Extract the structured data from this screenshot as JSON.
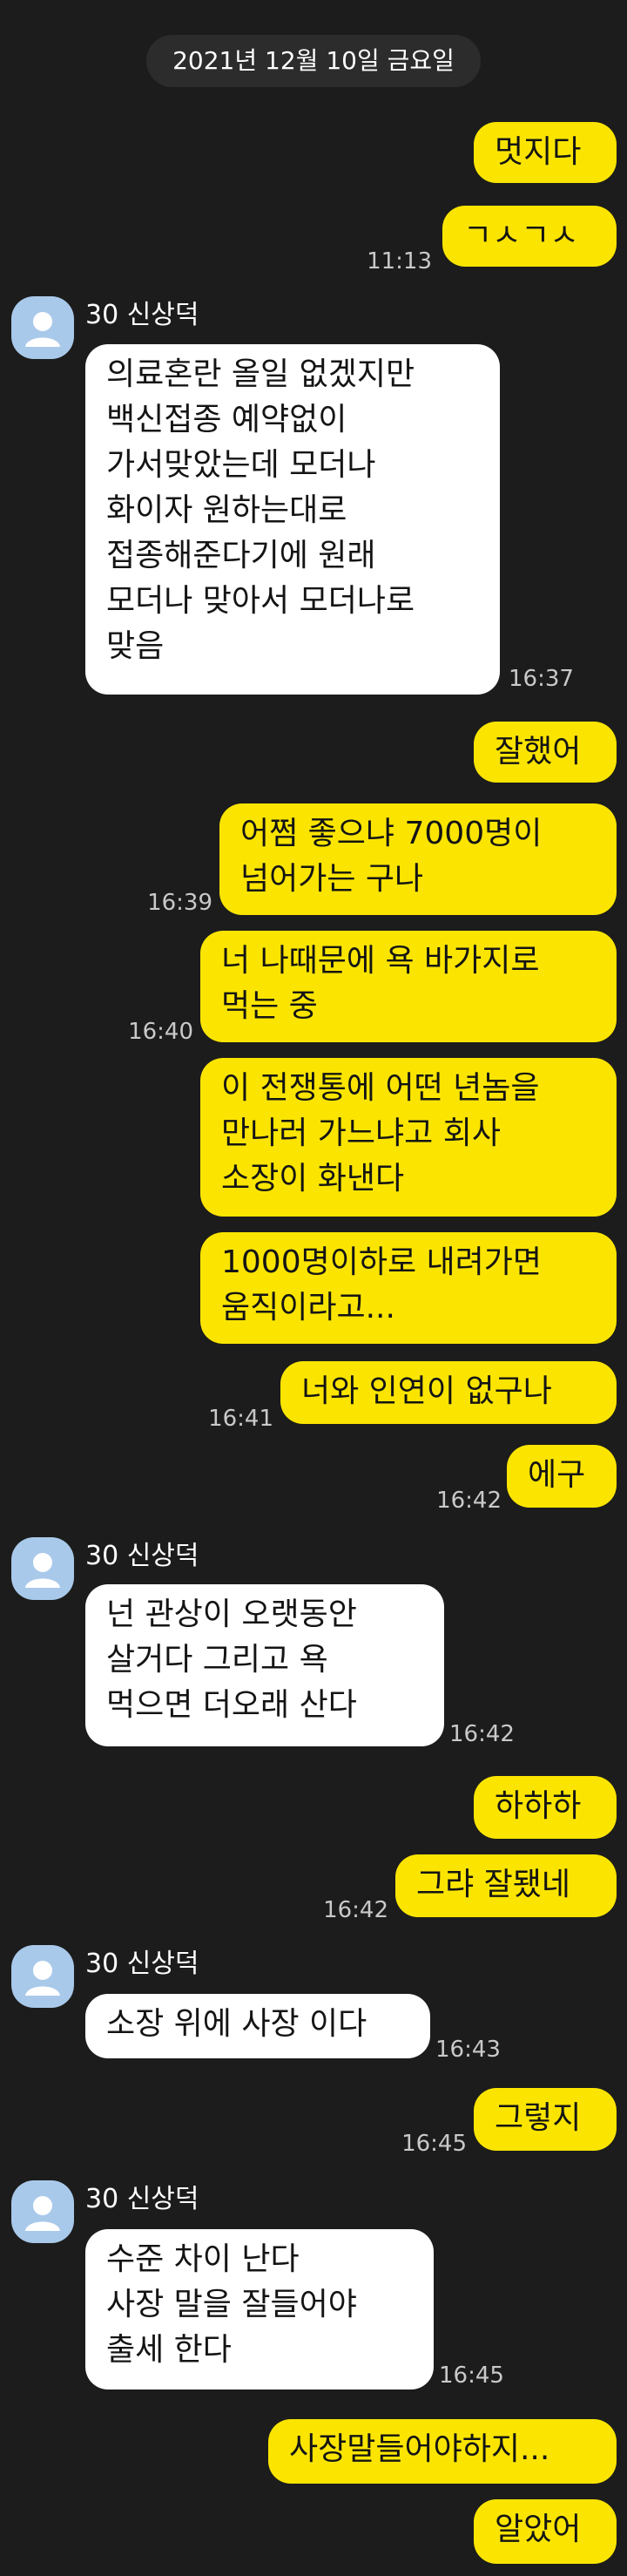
{
  "date_divider": "2021년 12월 10일 금요일",
  "peer_name": "30 신상덕",
  "messages": [
    {
      "from": "me",
      "text": "멋지다"
    },
    {
      "from": "me",
      "text": "ㄱㅅㄱㅅ",
      "time": "11:13"
    },
    {
      "from": "peer",
      "text": "의료혼란 올일 없겠지만\n백신접종 예약없이\n가서맞았는데 모더나\n화이자 원하는대로\n접종해준다기에 원래\n모더나 맞아서 모더나로\n맞음",
      "time": "16:37"
    },
    {
      "from": "me",
      "text": "잘했어"
    },
    {
      "from": "me",
      "text": "어쩜 좋으냐 7000명이\n넘어가는 구나",
      "time": "16:39"
    },
    {
      "from": "me",
      "text": "너 나때문에 욕 바가지로\n먹는 중",
      "time": "16:40"
    },
    {
      "from": "me",
      "text": "이 전쟁통에 어떤 년놈을\n만나러 가느냐고 회사\n소장이 화낸다"
    },
    {
      "from": "me",
      "text": "1000명이하로 내려가면\n움직이라고..."
    },
    {
      "from": "me",
      "text": "너와 인연이 없구나",
      "time": "16:41"
    },
    {
      "from": "me",
      "text": "에구",
      "time": "16:42"
    },
    {
      "from": "peer",
      "text": "넌 관상이 오랫동안\n살거다  그리고 욕\n먹으면 더오래 산다",
      "time": "16:42"
    },
    {
      "from": "me",
      "text": "하하하"
    },
    {
      "from": "me",
      "text": "그랴 잘됐네",
      "time": "16:42"
    },
    {
      "from": "peer",
      "text": "소장 위에 사장 이다",
      "time": "16:43"
    },
    {
      "from": "me",
      "text": "그렇지",
      "time": "16:45"
    },
    {
      "from": "peer",
      "text": "수준 차이 난다\n사장 말을 잘들어야\n출세 한다",
      "time": "16:45"
    },
    {
      "from": "me",
      "text": "사장말들어야하지..."
    },
    {
      "from": "me",
      "text": "알았어"
    }
  ],
  "colors": {
    "background": "#1c1c1c",
    "my_bubble": "#fbe500",
    "peer_bubble": "#ffffff",
    "avatar": "#a9c9ea"
  },
  "icons": {
    "avatar": "default-person-avatar-icon"
  }
}
